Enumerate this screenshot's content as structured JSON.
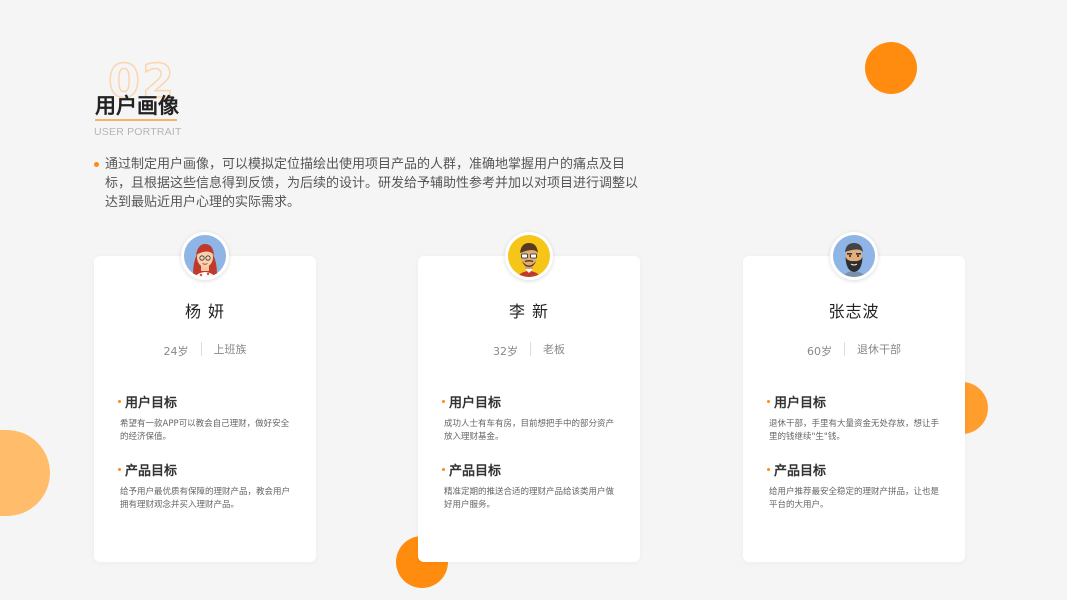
{
  "header": {
    "number": "02",
    "title": "用户画像",
    "subtitle": "USER PORTRAIT",
    "intro": "通过制定用户画像，可以模拟定位描绘出使用项目产品的人群，准确地掌握用户的痛点及目标，且根据这些信息得到反馈，为后续的设计。研发给予辅助性参考并加以对项目进行调整以达到最贴近用户心理的实际需求。"
  },
  "colors": {
    "accent": "#ff8c0f",
    "background": "#f5f5f5"
  },
  "cards": [
    {
      "avatar_icon": "woman-red-hair-avatar-icon",
      "name": "杨 妍",
      "age": "24岁",
      "occupation": "上班族",
      "goal_heading": "用户目标",
      "goal_text": "希望有一款APP可以教会自己理财，做好安全的经济保值。",
      "product_heading": "产品目标",
      "product_text": "给予用户最优质有保障的理财产品，教会用户拥有理财观念并买入理财产品。"
    },
    {
      "avatar_icon": "man-glasses-beard-avatar-icon",
      "name": "李 新",
      "age": "32岁",
      "occupation": "老板",
      "goal_heading": "用户目标",
      "goal_text": "成功人士有车有房，目前想把手中的部分资产放入理财基金。",
      "product_heading": "产品目标",
      "product_text": "精准定期的推送合适的理财产品给该类用户做好用户服务。"
    },
    {
      "avatar_icon": "man-full-beard-avatar-icon",
      "name": "张志波",
      "age": "60岁",
      "occupation": "退休干部",
      "goal_heading": "用户目标",
      "goal_text": "退休干部，手里有大量资金无处存放，想让手里的钱继续\"生\"钱。",
      "product_heading": "产品目标",
      "product_text": "给用户推荐最安全稳定的理财产拼品，让也是平台的大用户。"
    }
  ]
}
